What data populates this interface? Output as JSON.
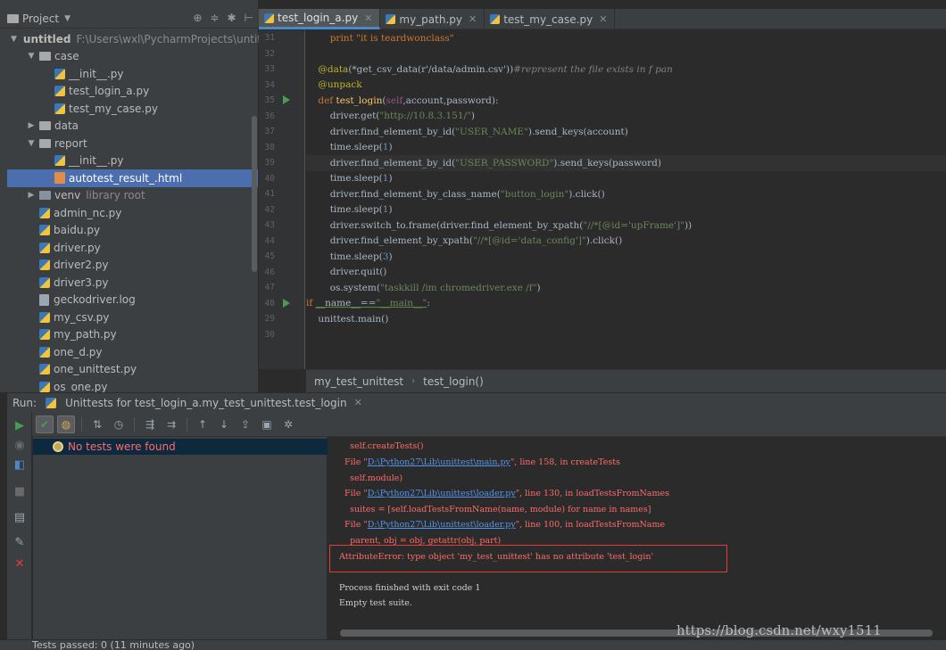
{
  "project": {
    "title": "Project",
    "tree": [
      {
        "label": "untitled",
        "extra": "F:\\Users\\wxl\\PycharmProjects\\untitle",
        "kind": "folder-root",
        "indent": 0,
        "arrow": "down"
      },
      {
        "label": "case",
        "kind": "folder",
        "indent": 1,
        "arrow": "down"
      },
      {
        "label": "__init__.py",
        "kind": "py",
        "indent": 2
      },
      {
        "label": "test_login_a.py",
        "kind": "py",
        "indent": 2
      },
      {
        "label": "test_my_case.py",
        "kind": "py",
        "indent": 2
      },
      {
        "label": "data",
        "kind": "folder",
        "indent": 1,
        "arrow": "right"
      },
      {
        "label": "report",
        "kind": "folder",
        "indent": 1,
        "arrow": "down"
      },
      {
        "label": "__init__.py",
        "kind": "py",
        "indent": 2
      },
      {
        "label": "autotest_result_.html",
        "kind": "html",
        "indent": 2,
        "selected": true
      },
      {
        "label": "venv",
        "extra": "library root",
        "kind": "folder-dark",
        "indent": 1,
        "arrow": "right"
      },
      {
        "label": "admin_nc.py",
        "kind": "py",
        "indent": 1
      },
      {
        "label": "baidu.py",
        "kind": "py",
        "indent": 1
      },
      {
        "label": "driver.py",
        "kind": "py",
        "indent": 1
      },
      {
        "label": "driver2.py",
        "kind": "py",
        "indent": 1
      },
      {
        "label": "driver3.py",
        "kind": "py",
        "indent": 1
      },
      {
        "label": "geckodriver.log",
        "kind": "file",
        "indent": 1
      },
      {
        "label": "my_csv.py",
        "kind": "py",
        "indent": 1
      },
      {
        "label": "my_path.py",
        "kind": "py",
        "indent": 1
      },
      {
        "label": "one_d.py",
        "kind": "py",
        "indent": 1
      },
      {
        "label": "one_unittest.py",
        "kind": "py",
        "indent": 1
      },
      {
        "label": "os_one.py",
        "kind": "py",
        "indent": 1
      }
    ]
  },
  "editor": {
    "tabs": [
      {
        "label": "test_login_a.py",
        "active": true
      },
      {
        "label": "my_path.py",
        "active": false
      },
      {
        "label": "test_my_case.py",
        "active": false
      }
    ],
    "line_numbers": [
      "31",
      "32",
      "33",
      "34",
      "35",
      "36",
      "37",
      "38",
      "39",
      "40",
      "41",
      "42",
      "43",
      "44",
      "45",
      "46",
      "47",
      "48",
      "29",
      "30"
    ],
    "breadcrumb": [
      "my_test_unittest",
      "test_login()"
    ]
  },
  "code": {
    "l31": "        print \"it is teardwonclass\"",
    "l33_dec": "    @data",
    "l33_rest": "(*get_csv_data(r'/data/admin.csv'))",
    "l33_cmt": "#represent the file exists in f pan",
    "l34": "    @unpack",
    "l35_kw": "    def ",
    "l35_fn": "test_login",
    "l35_open": "(",
    "l35_self": "self",
    "l35_args": ",account,password):",
    "l36_a": "        driver.get(",
    "l36_s": "\"http://10.8.3.151/\"",
    "l36_b": ")",
    "l37_a": "        driver.find_element_by_id(",
    "l37_s": "\"USER_NAME\"",
    "l37_b": ").send_keys(account)",
    "l38_a": "        time.sleep(",
    "l38_n": "1",
    "l38_b": ")",
    "l39_a": "        driver.find_element_by_id(",
    "l39_s": "\"USER_PASSWORD\"",
    "l39_b": ").send_keys(password)",
    "l40_a": "        time.sleep(",
    "l40_n": "1",
    "l40_b": ")",
    "l41_a": "        driver.find_element_by_class_name(",
    "l41_s": "\"button_login\"",
    "l41_b": ").click()",
    "l42_a": "        time.sleep(",
    "l42_n": "1",
    "l42_b": ")",
    "l43_a": "        driver.switch_to.frame(driver.find_element_by_xpath(",
    "l43_s": "\"//*[@id='upFrame']\"",
    "l43_b": "))",
    "l44_a": "        driver.find_element_by_xpath(",
    "l44_s": "\"//*[@id='data_config']\"",
    "l44_b": ").click()",
    "l45_a": "        time.sleep(",
    "l45_n": "3",
    "l45_b": ")",
    "l46": "        driver.quit()",
    "l47_a": "        os.system(",
    "l47_s": "\"taskkill /im chromedriver.exe /f\"",
    "l47_b": ")",
    "l48_kw": "if ",
    "l48_a": "__name__==",
    "l48_s": "\"__main__\"",
    "l48_b": ":",
    "l29": "    unittest.main()"
  },
  "run": {
    "label": "Run:",
    "title": "Unittests for test_login_a.my_test_unittest.test_login",
    "no_tests": "No tests were found"
  },
  "console": {
    "c1": "    self.createTests()",
    "c2_a": "  File \"",
    "c2_link": "D:\\Python27\\Lib\\unittest\\main.py",
    "c2_b": "\", line 158, in createTests",
    "c3": "    self.module)",
    "c4_a": "  File \"",
    "c4_link": "D:\\Python27\\Lib\\unittest\\loader.py",
    "c4_b": "\", line 130, in loadTestsFromNames",
    "c5": "    suites = [self.loadTestsFromName(name, module) for name in names]",
    "c6_a": "  File \"",
    "c6_link": "D:\\Python27\\Lib\\unittest\\loader.py",
    "c6_b": "\", line 100, in loadTestsFromName",
    "c7": "    parent, obj = obj, getattr(obj, part)",
    "c8": "AttributeError: type object 'my_test_unittest' has no attribute 'test_login'",
    "c9": "Process finished with exit code 1",
    "c10": "Empty test suite."
  },
  "status": {
    "text": "Tests passed: 0 (11 minutes ago)"
  },
  "watermark": "https://blog.csdn.net/wxy1511",
  "colors": {
    "keyword": "#cc7832",
    "string": "#6a8759",
    "decorator": "#bbb529",
    "function": "#ffc66d",
    "error": "#ff6b68",
    "selection": "#4b6eaf"
  }
}
